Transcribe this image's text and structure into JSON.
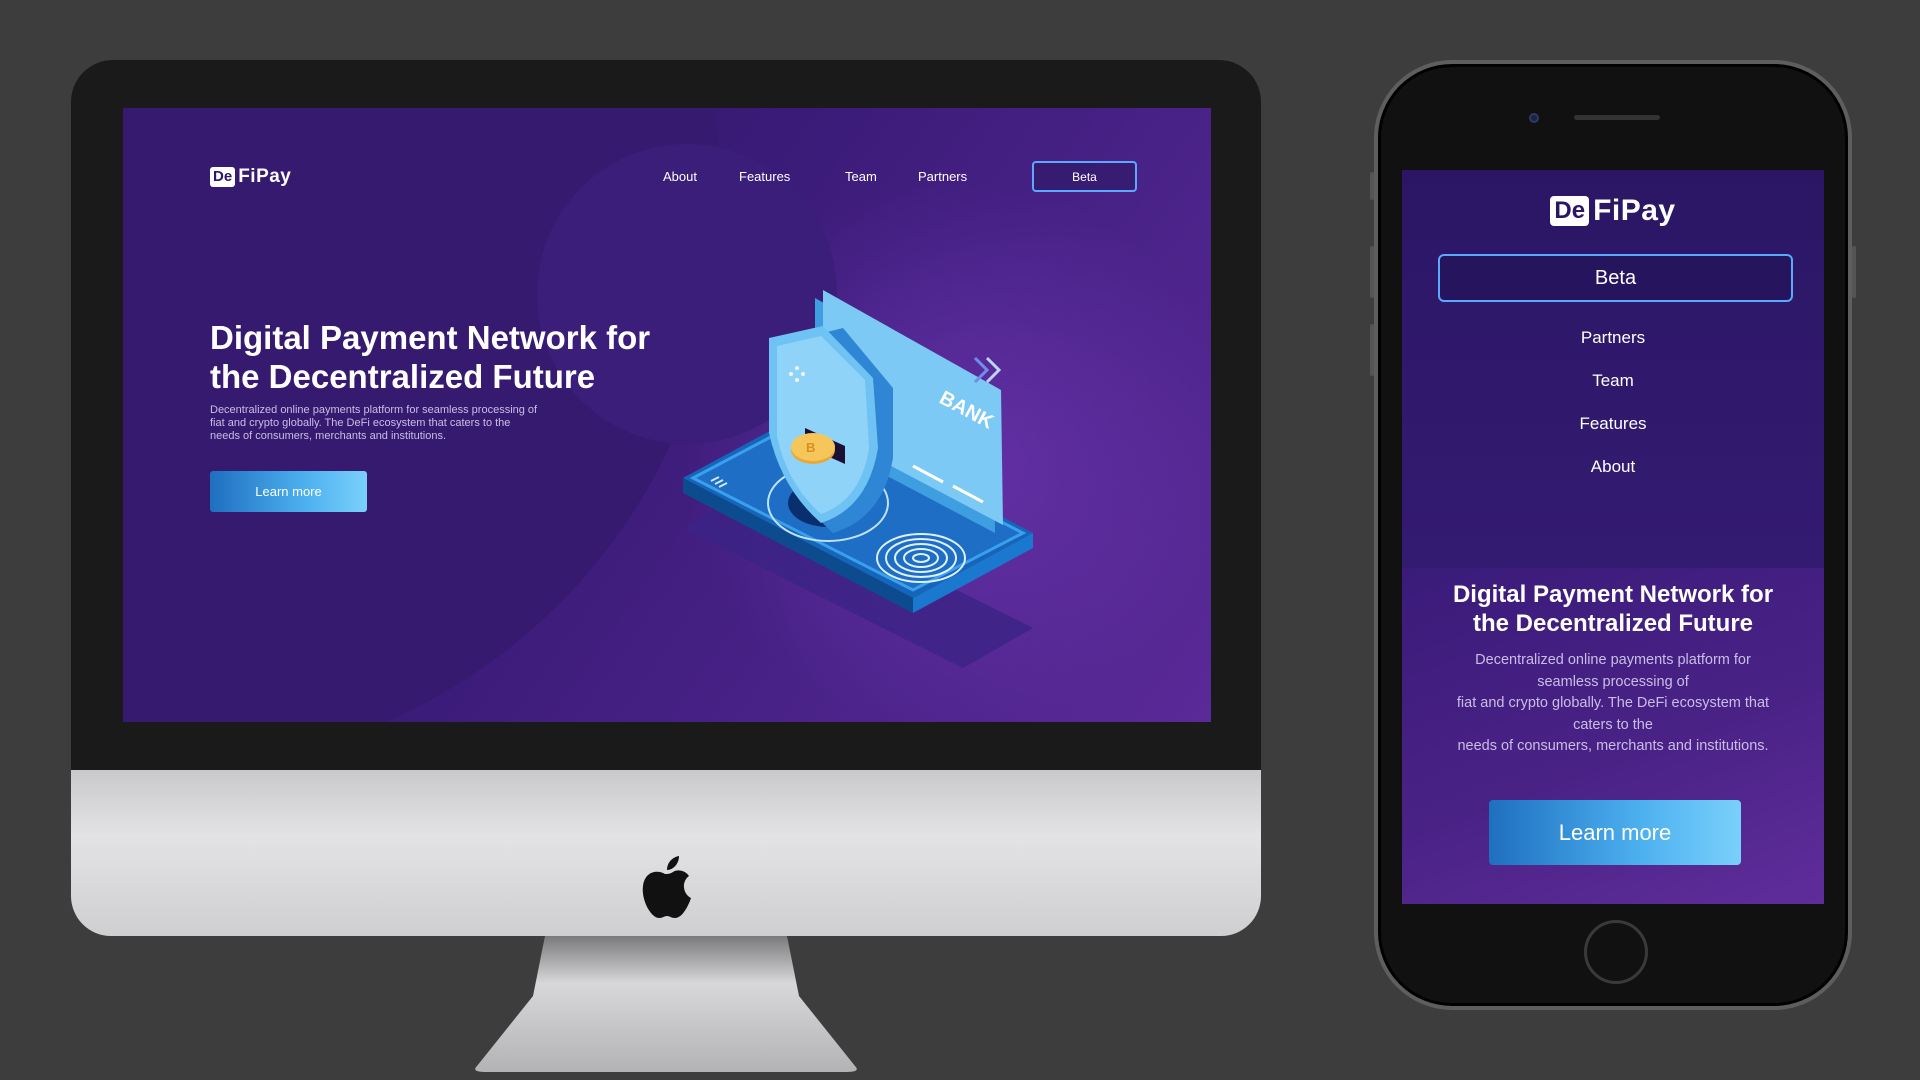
{
  "brand": {
    "logo_badge": "De",
    "logo_text": "FiPay"
  },
  "desktop": {
    "nav": [
      {
        "label": "About"
      },
      {
        "label": "Features"
      },
      {
        "label": "Team"
      },
      {
        "label": "Partners"
      }
    ],
    "beta_label": "Beta",
    "hero": {
      "title_line1": "Digital Payment Network for",
      "title_line2": "the Decentralized Future",
      "desc_line1": "Decentralized online payments platform for seamless processing of",
      "desc_line2": "fiat and crypto globally. The DeFi ecosystem that caters to the",
      "desc_line3": "needs of consumers, merchants and institutions.",
      "cta_label": "Learn more"
    },
    "illustration": {
      "card_text": "BANK"
    }
  },
  "mobile": {
    "beta_label": "Beta",
    "nav": [
      {
        "label": "Partners"
      },
      {
        "label": "Team"
      },
      {
        "label": "Features"
      },
      {
        "label": "About"
      }
    ],
    "hero": {
      "title_line1": "Digital Payment Network for",
      "title_line2": "the Decentralized Future",
      "desc_lines": [
        "Decentralized online payments platform for",
        "seamless processing of",
        "fiat and crypto globally. The DeFi ecosystem that",
        "caters to the",
        "needs of consumers, merchants and institutions."
      ],
      "cta_label": "Learn more"
    }
  },
  "colors": {
    "background": "#3d3d3d",
    "page_purple": "#2e1866",
    "accent_blue": "#4cb0ef",
    "beta_border": "#5aa9ff"
  },
  "icons": [
    "apple-logo-icon",
    "double-chevron-icon",
    "shield-icon",
    "bitcoin-coin-icon",
    "fingerprint-icon"
  ]
}
